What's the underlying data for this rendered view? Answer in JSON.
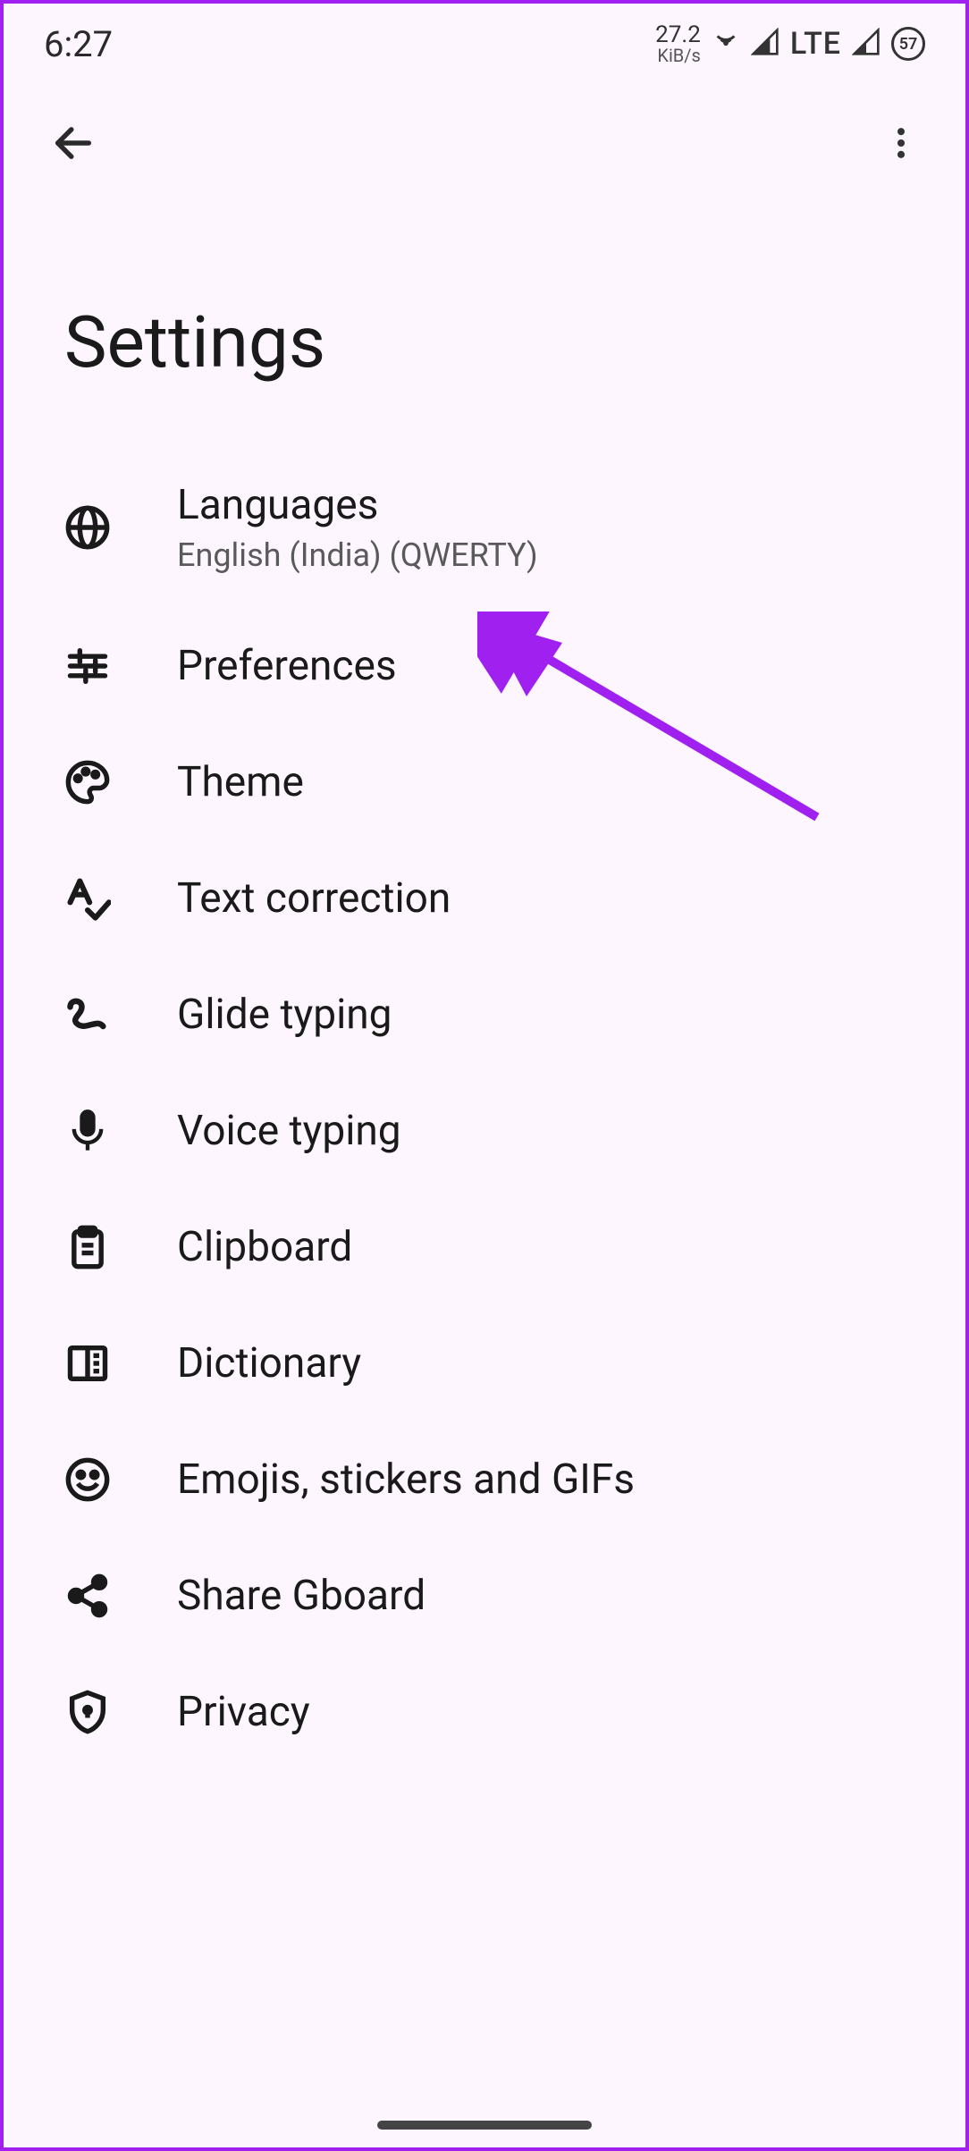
{
  "statusbar": {
    "time": "6:27",
    "kibs_value": "27.2",
    "kibs_unit": "KiB/s",
    "network": "LTE",
    "battery": "57"
  },
  "page": {
    "title": "Settings"
  },
  "items": [
    {
      "title": "Languages",
      "subtitle": "English (India) (QWERTY)",
      "icon": "globe-icon"
    },
    {
      "title": "Preferences",
      "subtitle": "",
      "icon": "sliders-icon"
    },
    {
      "title": "Theme",
      "subtitle": "",
      "icon": "palette-icon"
    },
    {
      "title": "Text correction",
      "subtitle": "",
      "icon": "spellcheck-icon"
    },
    {
      "title": "Glide typing",
      "subtitle": "",
      "icon": "squiggle-icon"
    },
    {
      "title": "Voice typing",
      "subtitle": "",
      "icon": "microphone-icon"
    },
    {
      "title": "Clipboard",
      "subtitle": "",
      "icon": "clipboard-icon"
    },
    {
      "title": "Dictionary",
      "subtitle": "",
      "icon": "book-icon"
    },
    {
      "title": "Emojis, stickers and GIFs",
      "subtitle": "",
      "icon": "emoji-icon"
    },
    {
      "title": "Share Gboard",
      "subtitle": "",
      "icon": "share-icon"
    },
    {
      "title": "Privacy",
      "subtitle": "",
      "icon": "shield-icon"
    }
  ]
}
